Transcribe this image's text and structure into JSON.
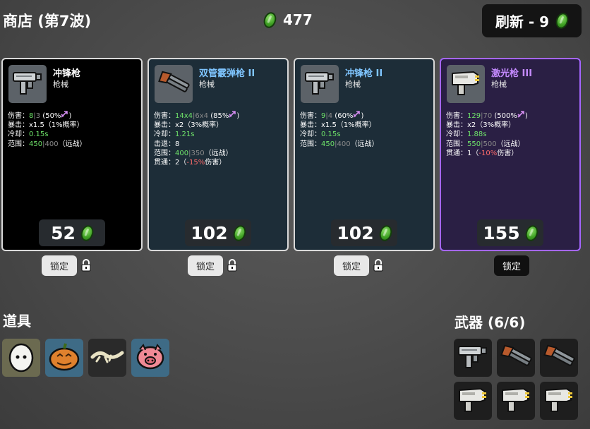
{
  "header": {
    "shop_title": "商店 (第7波)",
    "coins": "477",
    "refresh_label": "刷新 - 9"
  },
  "colors": {
    "card_bg_tier1": "#000000",
    "card_bg_tier2": "#1d2d38",
    "card_bg_tier3": "#2a1f44",
    "tier3_border": "#a566ff",
    "tier2_name": "#7fc5ff",
    "tier3_name": "#c48aff",
    "stat_green": "#6fe36a",
    "material_green": "#3ea023"
  },
  "cards": [
    {
      "name": "冲锋枪",
      "type": "枪械",
      "icon": "smg-icon",
      "stats": [
        {
          "label": "伤害：",
          "main": "8",
          "sep": "|",
          "sub": "3",
          "extra": " (50%",
          "icon": "ranged-icon",
          "tail": ")"
        },
        {
          "label": "暴击：",
          "text": "x1.5（1%概率）"
        },
        {
          "label": "冷却：",
          "main": "0.15s"
        },
        {
          "label": "范围：",
          "main": "450",
          "sep": "|",
          "sub": "400",
          "tail": "（远战）"
        }
      ],
      "price": "52",
      "lock_label": "锁定"
    },
    {
      "name": "双管霰弹枪 II",
      "type": "枪械",
      "icon": "double-barrel-shotgun-icon",
      "stats": [
        {
          "label": "伤害：",
          "main": "14x4",
          "sep": "|",
          "sub": "6x4",
          "extra": " (85%",
          "icon": "ranged-icon",
          "tail": ")"
        },
        {
          "label": "暴击：",
          "text": "x2（3%概率）"
        },
        {
          "label": "冷却：",
          "main": "1.21s"
        },
        {
          "label": "击退：",
          "text": "8"
        },
        {
          "label": "范围：",
          "main": "400",
          "sep": "|",
          "sub": "350",
          "tail": "（远战）"
        },
        {
          "label": "贯通：",
          "text": "2（",
          "neg": "-15%",
          "tail": "伤害）"
        }
      ],
      "price": "102",
      "lock_label": "锁定"
    },
    {
      "name": "冲锋枪 II",
      "type": "枪械",
      "icon": "smg-icon",
      "stats": [
        {
          "label": "伤害：",
          "main": "9",
          "sep": "|",
          "sub": "4",
          "extra": " (60%",
          "icon": "ranged-icon",
          "tail": ")"
        },
        {
          "label": "暴击：",
          "text": "x1.5（1%概率）"
        },
        {
          "label": "冷却：",
          "main": "0.15s"
        },
        {
          "label": "范围：",
          "main": "450",
          "sep": "|",
          "sub": "400",
          "tail": "（远战）"
        }
      ],
      "price": "102",
      "lock_label": "锁定"
    },
    {
      "name": "激光枪 III",
      "type": "枪械",
      "icon": "laser-gun-icon",
      "stats": [
        {
          "label": "伤害：",
          "main": "129",
          "sep": "|",
          "sub": "70",
          "extra": " (500%",
          "icon": "ranged-icon",
          "tail": ")"
        },
        {
          "label": "暴击：",
          "text": "x2（3%概率）"
        },
        {
          "label": "冷却：",
          "main": "1.88s"
        },
        {
          "label": "范围：",
          "main": "550",
          "sep": "|",
          "sub": "500",
          "tail": "（远战）"
        },
        {
          "label": "贯通：",
          "text": "1（",
          "neg": "-10%",
          "tail": "伤害）"
        }
      ],
      "price": "155",
      "lock_label": "锁定"
    }
  ],
  "items_section": {
    "title": "道具",
    "items": [
      {
        "icon": "egg-icon"
      },
      {
        "icon": "pumpkin-icon"
      },
      {
        "icon": "lizard-tail-icon"
      },
      {
        "icon": "piggy-bank-icon"
      }
    ]
  },
  "weapons_section": {
    "title": "武器 (6/6)",
    "weapons": [
      {
        "icon": "smg-icon"
      },
      {
        "icon": "double-barrel-shotgun-icon"
      },
      {
        "icon": "double-barrel-shotgun-icon"
      },
      {
        "icon": "laser-gun-icon"
      },
      {
        "icon": "laser-gun-icon"
      },
      {
        "icon": "laser-gun-icon"
      }
    ]
  }
}
